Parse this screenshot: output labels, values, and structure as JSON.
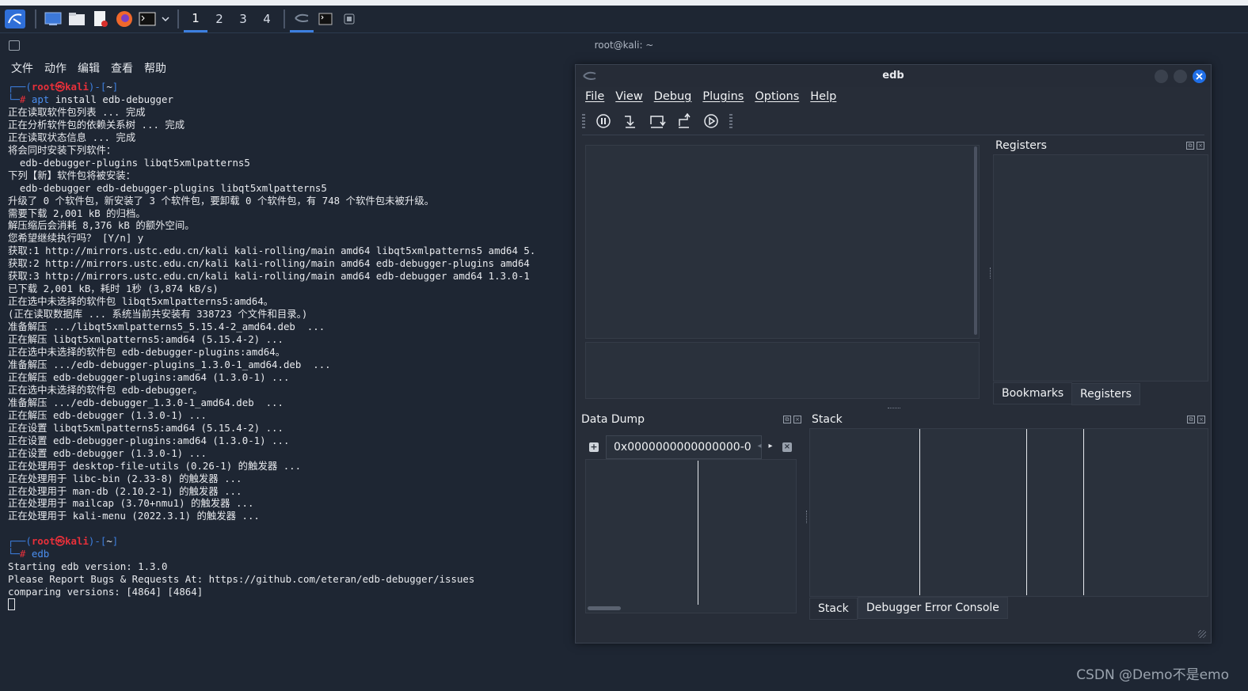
{
  "panel": {
    "workspaces": [
      "1",
      "2",
      "3",
      "4"
    ],
    "active_workspace": "1"
  },
  "terminal": {
    "title": "root@kali: ~",
    "menu": [
      "文件",
      "动作",
      "编辑",
      "查看",
      "帮助"
    ],
    "prompt_user": "root㉿kali",
    "prompt_dir": "~",
    "cmd1_prefix": "apt",
    "cmd1_rest": " install edb-debugger",
    "output1": [
      "正在读取软件包列表 ... 完成",
      "正在分析软件包的依赖关系树 ... 完成",
      "正在读取状态信息 ... 完成",
      "将会同时安装下列软件：",
      "  edb-debugger-plugins libqt5xmlpatterns5",
      "下列【新】软件包将被安装：",
      "  edb-debugger edb-debugger-plugins libqt5xmlpatterns5",
      "升级了 0 个软件包，新安装了 3 个软件包，要卸载 0 个软件包，有 748 个软件包未被升级。",
      "需要下载 2,001 kB 的归档。",
      "解压缩后会消耗 8,376 kB 的额外空间。",
      "您希望继续执行吗？ [Y/n] y",
      "获取:1 http://mirrors.ustc.edu.cn/kali kali-rolling/main amd64 libqt5xmlpatterns5 amd64 5.",
      "获取:2 http://mirrors.ustc.edu.cn/kali kali-rolling/main amd64 edb-debugger-plugins amd64",
      "获取:3 http://mirrors.ustc.edu.cn/kali kali-rolling/main amd64 edb-debugger amd64 1.3.0-1",
      "已下载 2,001 kB，耗时 1秒 (3,874 kB/s)",
      "正在选中未选择的软件包 libqt5xmlpatterns5:amd64。",
      "(正在读取数据库 ... 系统当前共安装有 338723 个文件和目录。)",
      "准备解压 .../libqt5xmlpatterns5_5.15.4-2_amd64.deb  ...",
      "正在解压 libqt5xmlpatterns5:amd64 (5.15.4-2) ...",
      "正在选中未选择的软件包 edb-debugger-plugins:amd64。",
      "准备解压 .../edb-debugger-plugins_1.3.0-1_amd64.deb  ...",
      "正在解压 edb-debugger-plugins:amd64 (1.3.0-1) ...",
      "正在选中未选择的软件包 edb-debugger。",
      "准备解压 .../edb-debugger_1.3.0-1_amd64.deb  ...",
      "正在解压 edb-debugger (1.3.0-1) ...",
      "正在设置 libqt5xmlpatterns5:amd64 (5.15.4-2) ...",
      "正在设置 edb-debugger-plugins:amd64 (1.3.0-1) ...",
      "正在设置 edb-debugger (1.3.0-1) ...",
      "正在处理用于 desktop-file-utils (0.26-1) 的触发器 ...",
      "正在处理用于 libc-bin (2.33-8) 的触发器 ...",
      "正在处理用于 man-db (2.10.2-1) 的触发器 ...",
      "正在处理用于 mailcap (3.70+nmu1) 的触发器 ...",
      "正在处理用于 kali-menu (2022.3.1) 的触发器 ..."
    ],
    "cmd2": "edb",
    "output2": [
      "Starting edb version: 1.3.0",
      "Please Report Bugs & Requests At: https://github.com/eteran/edb-debugger/issues",
      "comparing versions: [4864] [4864]"
    ]
  },
  "edb": {
    "title": "edb",
    "menu": [
      "File",
      "View",
      "Debug",
      "Plugins",
      "Options",
      "Help"
    ],
    "toolbar_icons": [
      "pause-icon",
      "step-into-icon",
      "step-over-icon",
      "step-out-icon",
      "run-icon"
    ],
    "registers_title": "Registers",
    "right_tabs": [
      "Bookmarks",
      "Registers"
    ],
    "data_dump_title": "Data Dump",
    "address_value": "0x0000000000000000-0",
    "stack_title": "Stack",
    "bottom_tabs": [
      "Stack",
      "Debugger Error Console"
    ]
  },
  "watermark": "CSDN @Demo不是emo",
  "colors": {
    "prompt_blue": "#3d7fe0",
    "prompt_red": "#e8303a",
    "close_button": "#1f6fe8"
  }
}
